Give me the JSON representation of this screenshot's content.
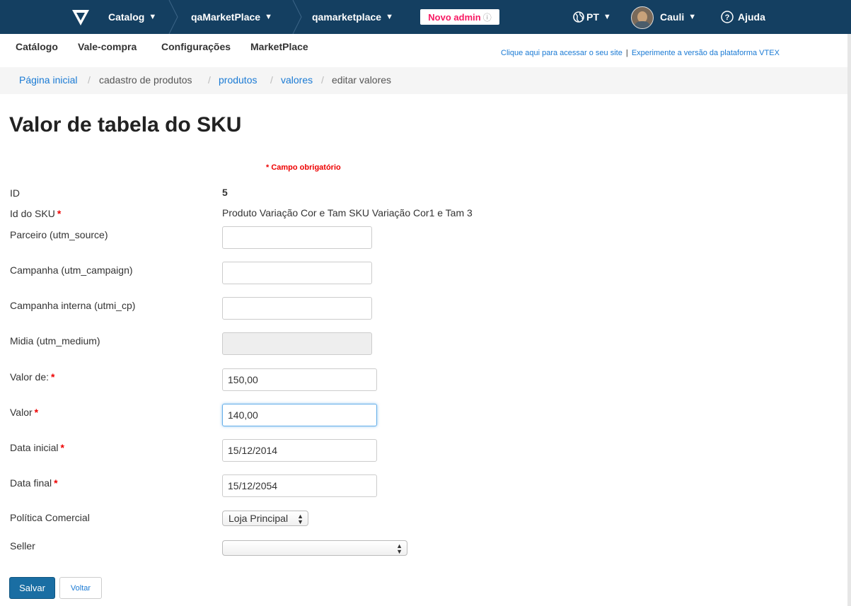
{
  "topbar": {
    "catalog_label": "Catalog",
    "account_label": "qaMarketPlace",
    "store_label": "qamarketplace",
    "novo_admin_label": "Novo admin",
    "language_label": "PT",
    "user_label": "Cauli",
    "help_label": "Ajuda",
    "bg_color": "#143f61"
  },
  "secnav": {
    "items": [
      "Catálogo",
      "Vale-compra",
      "Configurações",
      "MarketPlace"
    ],
    "site_link": "Clique aqui para acessar o seu site",
    "separator": "|",
    "platform_link": "Experimente a versão da plataforma VTEX"
  },
  "breadcrumb": {
    "home": "Página inicial",
    "cadastro": "cadastro de produtos",
    "produtos": "produtos",
    "valores": "valores",
    "current": "editar valores",
    "slash": "/"
  },
  "page_title": "Valor de tabela do SKU",
  "required_note": "* Campo obrigatório",
  "star": "*",
  "form": {
    "id_label": "ID",
    "id_value": "5",
    "sku_label": "Id do SKU",
    "sku_value": "Produto Variação Cor e Tam SKU Variação Cor1 e Tam 3",
    "parceiro_label": "Parceiro (utm_source)",
    "parceiro_value": "",
    "campanha_label": "Campanha (utm_campaign)",
    "campanha_value": "",
    "campanha_interna_label": "Campanha interna (utmi_cp)",
    "campanha_interna_value": "",
    "midia_label": "Midia (utm_medium)",
    "midia_value": "",
    "valor_de_label": "Valor de:",
    "valor_de_value": "150,00",
    "valor_label": "Valor",
    "valor_value": "140,00",
    "data_inicial_label": "Data inicial",
    "data_inicial_value": "15/12/2014",
    "data_final_label": "Data final",
    "data_final_value": "15/12/2054",
    "politica_label": "Política Comercial",
    "politica_value": "Loja Principal",
    "seller_label": "Seller",
    "seller_value": ""
  },
  "buttons": {
    "save": "Salvar",
    "back": "Voltar"
  },
  "colors": {
    "primary": "#1a6ea3",
    "link": "#1a7ad4",
    "required": "#e00000",
    "novo_admin": "#f71963"
  }
}
